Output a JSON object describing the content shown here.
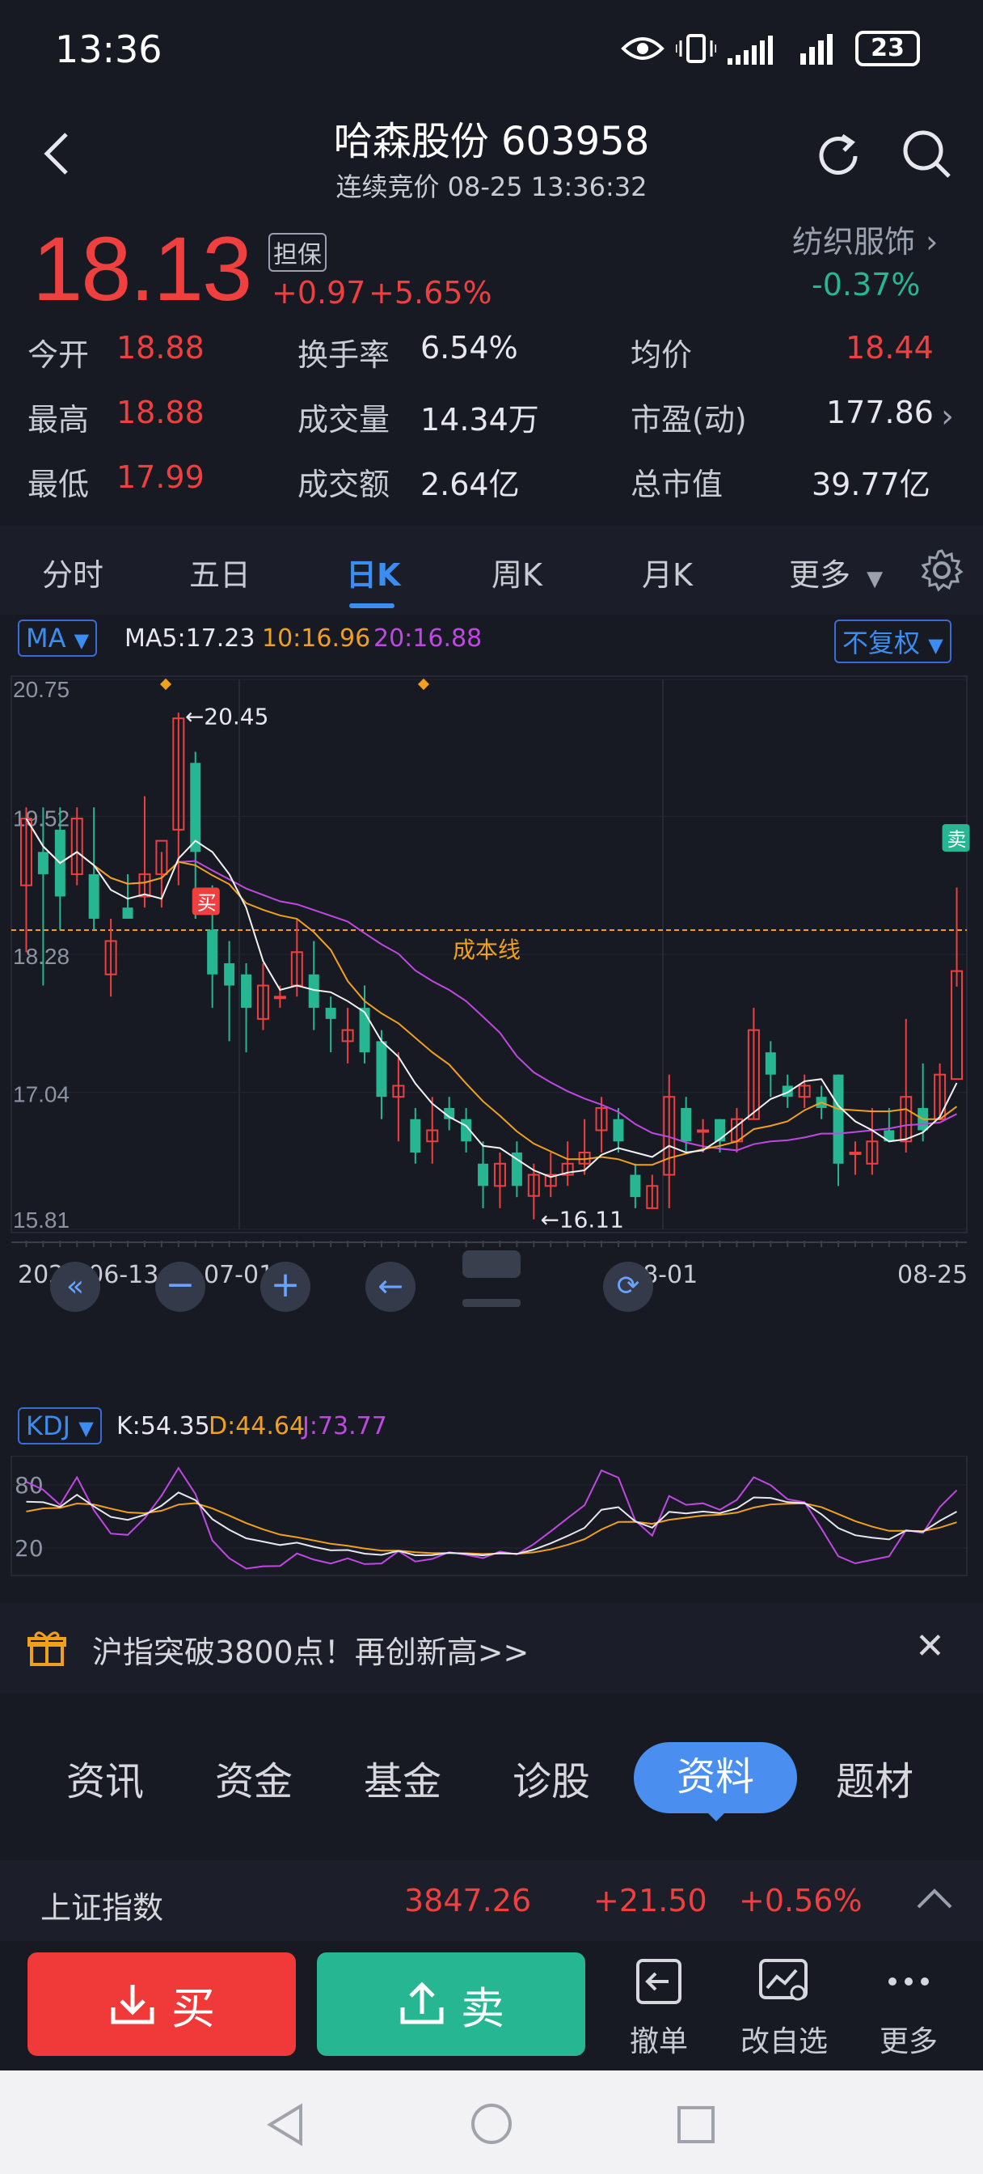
{
  "status_bar": {
    "time": "13:36",
    "battery": "23"
  },
  "header": {
    "title": "哈森股份 603958",
    "subtitle": "连续竞价 08-25 13:36:32"
  },
  "quote": {
    "price": "18.13",
    "tag": "担保",
    "change": "+0.97",
    "change_pct": "+5.65%",
    "sector_name": "纺织服饰",
    "sector_change": "-0.37%"
  },
  "stats": [
    {
      "label": "今开",
      "value": "18.88",
      "color": "#ef3f3f"
    },
    {
      "label": "换手率",
      "value": "6.54%",
      "color": "#e6e8ee"
    },
    {
      "label": "均价",
      "value": "18.44",
      "color": "#ef3f3f"
    },
    {
      "label": "最高",
      "value": "18.88",
      "color": "#ef3f3f"
    },
    {
      "label": "成交量",
      "value": "14.34万",
      "color": "#e6e8ee"
    },
    {
      "label": "市盈(动)",
      "value": "177.86",
      "color": "#e6e8ee"
    },
    {
      "label": "最低",
      "value": "17.99",
      "color": "#ef3f3f"
    },
    {
      "label": "成交额",
      "value": "2.64亿",
      "color": "#e6e8ee"
    },
    {
      "label": "总市值",
      "value": "39.77亿",
      "color": "#e6e8ee"
    }
  ],
  "ktabs": [
    {
      "label": "分时"
    },
    {
      "label": "五日"
    },
    {
      "label": "日K",
      "active": true
    },
    {
      "label": "周K"
    },
    {
      "label": "月K"
    },
    {
      "label": "更多"
    }
  ],
  "chart_indicator": {
    "ma_select": "MA",
    "ma5": "MA5:17.23",
    "ma10": "10:16.96",
    "ma20": "20:16.88",
    "adjust": "不复权",
    "cost_line_label": "成本线",
    "high_marker": "←20.45",
    "low_marker": "←16.11",
    "buy_marker": "买",
    "sell_marker": "卖"
  },
  "kdj": {
    "select": "KDJ",
    "k": "K:54.35",
    "d": "D:44.64",
    "j": "J:73.77",
    "ticks": [
      "80",
      "20"
    ]
  },
  "chart_data": {
    "type": "candlestick",
    "y_ticks": [
      "20.75",
      "19.52",
      "18.28",
      "17.04",
      "15.81"
    ],
    "ylim": [
      15.81,
      20.75
    ],
    "x_ticks": [
      "2025-06-13",
      "07-01",
      "08-01",
      "08-25"
    ],
    "cost_line": 18.28,
    "candles": [
      [
        18.9,
        19.5,
        19.6,
        18.3
      ],
      [
        19.2,
        19.0,
        19.6,
        18.0
      ],
      [
        19.4,
        18.8,
        19.6,
        18.5
      ],
      [
        19.0,
        19.5,
        19.6,
        18.9
      ],
      [
        19.0,
        18.6,
        19.6,
        18.5
      ],
      [
        18.1,
        18.4,
        18.6,
        17.9
      ],
      [
        18.7,
        18.6,
        19.0,
        18.6
      ],
      [
        18.8,
        19.0,
        19.7,
        18.7
      ],
      [
        19.0,
        19.3,
        19.2,
        18.7
      ],
      [
        19.4,
        20.4,
        20.45,
        18.9
      ],
      [
        20.0,
        19.2,
        20.1,
        18.6
      ],
      [
        18.5,
        18.1,
        18.9,
        17.8
      ],
      [
        18.2,
        18.0,
        18.4,
        17.5
      ],
      [
        18.1,
        17.8,
        18.2,
        17.4
      ],
      [
        17.7,
        18.0,
        18.2,
        17.6
      ],
      [
        17.9,
        17.9,
        18.0,
        17.8
      ],
      [
        18.0,
        18.3,
        18.6,
        17.9
      ],
      [
        18.1,
        17.8,
        18.4,
        17.6
      ],
      [
        17.8,
        17.7,
        17.9,
        17.4
      ],
      [
        17.5,
        17.6,
        17.8,
        17.3
      ],
      [
        17.8,
        17.4,
        18.0,
        17.3
      ],
      [
        17.5,
        17.0,
        17.6,
        16.8
      ],
      [
        17.0,
        17.1,
        17.4,
        16.6
      ],
      [
        16.8,
        16.5,
        16.9,
        16.4
      ],
      [
        16.6,
        16.7,
        17.0,
        16.4
      ],
      [
        16.9,
        16.8,
        17.0,
        16.7
      ],
      [
        16.8,
        16.6,
        16.9,
        16.5
      ],
      [
        16.4,
        16.2,
        16.6,
        16.0
      ],
      [
        16.2,
        16.4,
        16.5,
        16.0
      ],
      [
        16.5,
        16.2,
        16.6,
        16.1
      ],
      [
        16.11,
        16.3,
        16.4,
        15.9
      ],
      [
        16.2,
        16.3,
        16.5,
        16.1
      ],
      [
        16.3,
        16.4,
        16.6,
        16.2
      ],
      [
        16.4,
        16.5,
        16.8,
        16.3
      ],
      [
        16.7,
        16.9,
        17.0,
        16.5
      ],
      [
        16.8,
        16.6,
        16.9,
        16.5
      ],
      [
        16.3,
        16.1,
        16.4,
        16.0
      ],
      [
        16.0,
        16.2,
        16.3,
        16.0
      ],
      [
        16.3,
        17.0,
        17.2,
        16.0
      ],
      [
        16.9,
        16.6,
        17.0,
        16.5
      ],
      [
        16.7,
        16.7,
        16.8,
        16.5
      ],
      [
        16.8,
        16.6,
        16.8,
        16.5
      ],
      [
        16.6,
        16.8,
        16.9,
        16.5
      ],
      [
        16.8,
        17.6,
        17.8,
        16.8
      ],
      [
        17.4,
        17.2,
        17.5,
        17.0
      ],
      [
        17.1,
        17.0,
        17.2,
        16.9
      ],
      [
        17.0,
        17.1,
        17.2,
        16.9
      ],
      [
        17.0,
        16.9,
        17.1,
        16.8
      ],
      [
        17.2,
        16.4,
        17.2,
        16.2
      ],
      [
        16.5,
        16.5,
        16.6,
        16.3
      ],
      [
        16.4,
        16.6,
        16.9,
        16.3
      ],
      [
        16.7,
        16.6,
        16.9,
        16.6
      ],
      [
        16.6,
        17.0,
        17.7,
        16.5
      ],
      [
        16.9,
        16.7,
        17.3,
        16.6
      ],
      [
        16.8,
        17.2,
        17.3,
        16.8
      ],
      [
        17.16,
        18.13,
        18.88,
        17.99
      ]
    ],
    "ma_colors": {
      "ma5": "#f2f2f2",
      "ma10": "#f0a01d",
      "ma20": "#c048e2"
    },
    "kdj_series": [
      "K",
      "D",
      "J"
    ]
  },
  "news": {
    "text": "沪指突破3800点！再创新高>>"
  },
  "info_tabs": [
    {
      "label": "资讯"
    },
    {
      "label": "资金"
    },
    {
      "label": "基金"
    },
    {
      "label": "诊股"
    },
    {
      "label": "资料",
      "active": true
    },
    {
      "label": "题材"
    }
  ],
  "index_bar": {
    "name": "上证指数",
    "value": "3847.26",
    "change": "+21.50",
    "pct": "+0.56%"
  },
  "actions": {
    "buy": "买",
    "sell": "卖",
    "cancel": "撤单",
    "edit_watch": "改自选",
    "more": "更多"
  },
  "colors": {
    "up": "#ef3f3f",
    "down": "#26b692",
    "accent": "#3b8df2",
    "bg": "#171a23"
  }
}
